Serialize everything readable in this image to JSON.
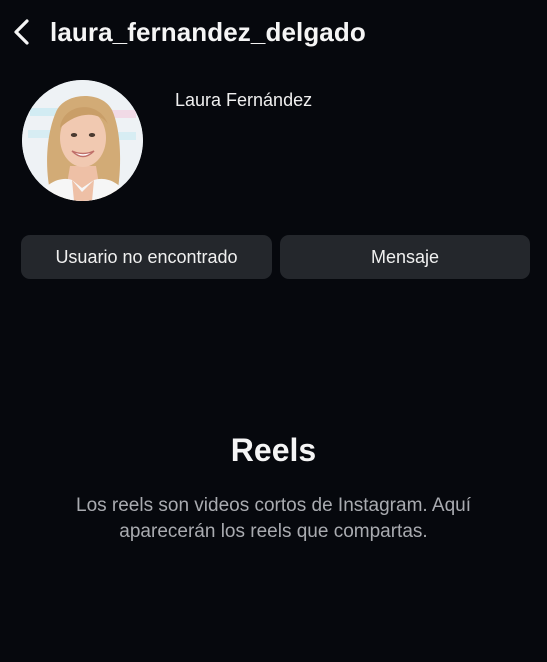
{
  "header": {
    "back_icon": "chevron-left-icon",
    "username": "laura_fernandez_delgado"
  },
  "profile": {
    "display_name": "Laura Fernández"
  },
  "actions": {
    "user_not_found_label": "Usuario no encontrado",
    "message_label": "Mensaje"
  },
  "empty_state": {
    "title": "Reels",
    "description": "Los reels son videos cortos de Instagram. Aquí aparecerán los reels que compartas."
  },
  "colors": {
    "background": "#06080d",
    "button": "#24272c",
    "text_primary": "#f5f5f5",
    "text_secondary": "#a9abb0"
  }
}
